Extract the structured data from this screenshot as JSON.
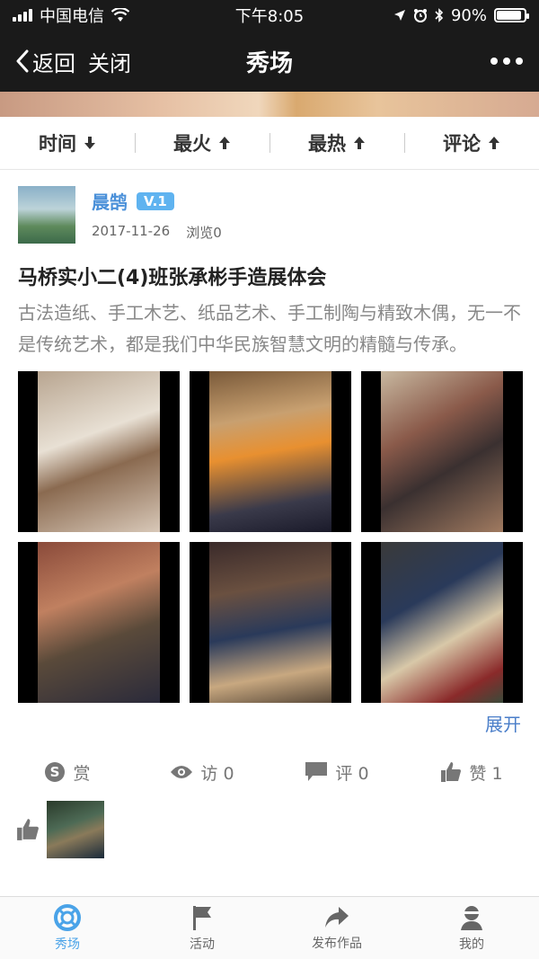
{
  "status_bar": {
    "carrier": "中国电信",
    "time": "下午8:05",
    "battery": "90%",
    "battery_level": 0.9
  },
  "nav": {
    "back_label": "返回",
    "close_label": "关闭",
    "title": "秀场"
  },
  "sort_tabs": [
    {
      "label": "时间",
      "arrow": "down"
    },
    {
      "label": "最火",
      "arrow": "up"
    },
    {
      "label": "最热",
      "arrow": "up"
    },
    {
      "label": "评论",
      "arrow": "up"
    }
  ],
  "post": {
    "author": "晨鹄",
    "badge": "V.1",
    "date": "2017-11-26",
    "views": "浏览0",
    "title": "马桥实小二(4)班张承彬手造展体会",
    "body": "古法造纸、手工木艺、纸品艺术、手工制陶与精致木偶，无一不是传统艺术，都是我们中华民族智慧文明的精髓与传承。",
    "expand_label": "展开",
    "actions": {
      "reward": "赏",
      "visits": "访 0",
      "comments": "评 0",
      "likes": "赞 1"
    }
  },
  "tabbar": {
    "items": [
      {
        "label": "秀场",
        "icon": "lifebuoy-icon",
        "active": true
      },
      {
        "label": "活动",
        "icon": "flag-icon",
        "active": false
      },
      {
        "label": "发布作品",
        "icon": "share-arrow-icon",
        "active": false
      },
      {
        "label": "我的",
        "icon": "user-icon",
        "active": false
      }
    ]
  },
  "colors": {
    "accent": "#4aa3e8",
    "link": "#4a7ec9",
    "nav_bg": "#1a1a1a"
  }
}
